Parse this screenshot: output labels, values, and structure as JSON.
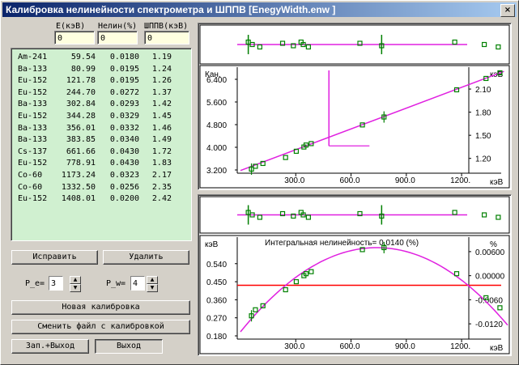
{
  "window": {
    "title": "Калибровка нелинейности спектрометра и ШППВ [EnegyWidth.enw ]",
    "close": "×"
  },
  "headers": {
    "energy": "E(кэВ)",
    "nonlin": "Нелин(%)",
    "fwhm": "ШППВ(кэВ)"
  },
  "inputs": {
    "energy": "0",
    "nonlin": "0",
    "fwhm": "0"
  },
  "lines": [
    {
      "iso": "Am-241",
      "e": "59.54",
      "nl": "0.0180",
      "w": "1.19"
    },
    {
      "iso": "Ba-133",
      "e": "80.99",
      "nl": "0.0195",
      "w": "1.24"
    },
    {
      "iso": "Eu-152",
      "e": "121.78",
      "nl": "0.0195",
      "w": "1.26"
    },
    {
      "iso": "Eu-152",
      "e": "244.70",
      "nl": "0.0272",
      "w": "1.37"
    },
    {
      "iso": "Ba-133",
      "e": "302.84",
      "nl": "0.0293",
      "w": "1.42"
    },
    {
      "iso": "Eu-152",
      "e": "344.28",
      "nl": "0.0329",
      "w": "1.45"
    },
    {
      "iso": "Ba-133",
      "e": "356.01",
      "nl": "0.0332",
      "w": "1.46"
    },
    {
      "iso": "Ba-133",
      "e": "383.85",
      "nl": "0.0340",
      "w": "1.49"
    },
    {
      "iso": "Cs-137",
      "e": "661.66",
      "nl": "0.0430",
      "w": "1.72"
    },
    {
      "iso": "Eu-152",
      "e": "778.91",
      "nl": "0.0430",
      "w": "1.83"
    },
    {
      "iso": "Co-60",
      "e": "1173.24",
      "nl": "0.0323",
      "w": "2.17"
    },
    {
      "iso": "Co-60",
      "e": "1332.50",
      "nl": "0.0256",
      "w": "2.35"
    },
    {
      "iso": "Eu-152",
      "e": "1408.01",
      "nl": "0.0200",
      "w": "2.42"
    }
  ],
  "buttons": {
    "fix": "Исправить",
    "delete": "Удалить",
    "new_calib": "Новая калибровка",
    "change_file": "Сменить файл с калибровкой",
    "save_exit": "Зап.+Выход",
    "exit": "Выход"
  },
  "spinners": {
    "pe_label": "P_e=",
    "pe_value": "3",
    "pw_label": "P_w=",
    "pw_value": "4"
  },
  "chart_data": [
    {
      "type": "scatter",
      "title": "",
      "ylabel_left": "Кан.",
      "ylabel_right": "кэВ",
      "xlabel": "кэВ",
      "xticks": [
        "300.0",
        "600.0",
        "900.0",
        "1200."
      ],
      "yticks_left": [
        "3.200",
        "4.000",
        "4.800",
        "5.600",
        "6.400"
      ],
      "yticks_right": [
        "1.20",
        "1.50",
        "1.80",
        "2.10"
      ],
      "ylim_left": [
        3.2,
        6.6
      ],
      "ylim_right": [
        1.15,
        2.45
      ],
      "xlim": [
        0,
        1450
      ],
      "points_x": [
        59.54,
        80.99,
        121.78,
        244.7,
        302.84,
        344.28,
        356.01,
        383.85,
        661.66,
        778.91,
        1173.24,
        1332.5,
        1408.01
      ],
      "points_y": [
        3.23,
        3.33,
        3.43,
        3.64,
        3.86,
        4.01,
        4.08,
        4.13,
        4.79,
        5.07,
        6.03,
        6.43,
        6.63
      ],
      "fit_line": [
        [
          0,
          3.18
        ],
        [
          1430,
          6.68
        ]
      ],
      "marker_x": 480
    },
    {
      "type": "scatter",
      "title": "Интегральная нелинейность= 0.0140 (%)",
      "ylabel_left": "кэВ",
      "ylabel_right": "%",
      "xlabel": "кэВ",
      "xticks": [
        "300.0",
        "600.0",
        "900.0",
        "1200."
      ],
      "yticks_left": [
        "0.180",
        "0.270",
        "0.360",
        "0.450",
        "0.540"
      ],
      "yticks_right": [
        "-0.0120",
        "-0.0060",
        "0.00000",
        "0.00600"
      ],
      "ylim_left": [
        0.18,
        0.64
      ],
      "xlim": [
        0,
        1450
      ],
      "reference_level": 0.432,
      "points_x": [
        59.54,
        80.99,
        121.78,
        244.7,
        302.84,
        344.28,
        356.01,
        383.85,
        661.66,
        778.91,
        1173.24,
        1332.5,
        1408.01
      ],
      "points_y": [
        0.28,
        0.31,
        0.33,
        0.41,
        0.45,
        0.48,
        0.49,
        0.5,
        0.61,
        0.62,
        0.49,
        0.37,
        0.32
      ]
    }
  ]
}
